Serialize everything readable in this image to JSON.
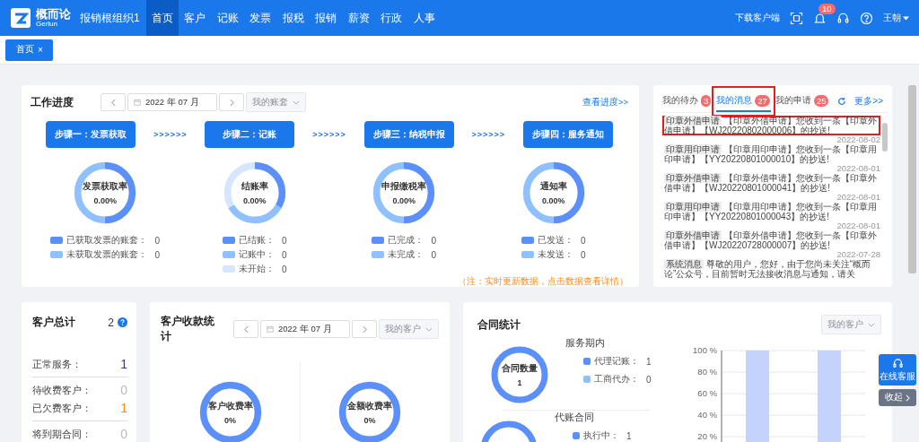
{
  "header": {
    "logo": {
      "name": "概而论",
      "subtitle": "Gerlun"
    },
    "org": "报销根组织1",
    "nav": [
      {
        "label": "首页",
        "selected": true
      },
      {
        "label": "客户",
        "selected": false
      },
      {
        "label": "记账",
        "selected": false
      },
      {
        "label": "发票",
        "selected": false
      },
      {
        "label": "报税",
        "selected": false
      },
      {
        "label": "报销",
        "selected": false
      },
      {
        "label": "薪资",
        "selected": false
      },
      {
        "label": "行政",
        "selected": false
      },
      {
        "label": "人事",
        "selected": false
      }
    ],
    "download": "下载客户端",
    "notification_count": "10",
    "user": "王朝"
  },
  "open_tabs": [
    {
      "label": "首页",
      "close": "×",
      "selected": true
    }
  ],
  "work_progress": {
    "title": "工作进度",
    "period": "2022 年 07 月",
    "account_select": "我的账套",
    "link": "查看进度>>",
    "steps": [
      {
        "label": "步骤一：发票获取",
        "connector": ">>>>>>",
        "rate_label": "发票获取率",
        "rate": "0.00%",
        "legend": [
          {
            "label": "已获取发票的账套：",
            "value": "0",
            "color": "#5b8ff9"
          },
          {
            "label": "未获取发票的账套：",
            "value": "0",
            "color": "#8fc0ff"
          }
        ]
      },
      {
        "label": "步骤二：记账",
        "connector": ">>>>>>",
        "rate_label": "结账率",
        "rate": "0.00%",
        "legend": [
          {
            "label": "已结账：",
            "value": "0",
            "color": "#5b8ff9"
          },
          {
            "label": "记账中：",
            "value": "0",
            "color": "#8fc0ff"
          },
          {
            "label": "未开始：",
            "value": "0",
            "color": "#d6e6ff"
          }
        ]
      },
      {
        "label": "步骤三：纳税申报",
        "connector": ">>>>>>",
        "rate_label": "申报缴税率",
        "rate": "0.00%",
        "legend": [
          {
            "label": "已完成：",
            "value": "0",
            "color": "#5b8ff9"
          },
          {
            "label": "未完成：",
            "value": "0",
            "color": "#8fc0ff"
          }
        ]
      },
      {
        "label": "步骤四：服务通知",
        "rate_label": "通知率",
        "rate": "0.00%",
        "legend": [
          {
            "label": "已发送：",
            "value": "0",
            "color": "#5b8ff9"
          },
          {
            "label": "未发送：",
            "value": "0",
            "color": "#8fc0ff"
          }
        ]
      }
    ],
    "note": "（注：实时更新数据，点击数据查看详情）"
  },
  "messages": {
    "tabs": [
      {
        "label": "我的待办",
        "count": "3",
        "selected": false,
        "highlighted": false
      },
      {
        "label": "我的消息",
        "count": "27",
        "selected": true,
        "highlighted": true
      },
      {
        "label": "我的申请",
        "count": "25",
        "selected": false,
        "highlighted": false
      }
    ],
    "more": "更多>>",
    "items": [
      {
        "tag": "印章外借申请",
        "text": "【印章外借申请】您收到一条【印章外借申请】【WJ20220802000006】的抄送!",
        "date": "2022-08-02",
        "highlighted": true
      },
      {
        "tag": "印章用印申请",
        "text": "【印章用印申请】您收到一条【印章用印申请】【YY20220801000010】的抄送!",
        "date": "2022-08-01",
        "highlighted": false
      },
      {
        "tag": "印章外借申请",
        "text": "【印章外借申请】您收到一条【印章外借申请】【WJ20220801000041】的抄送!",
        "date": "2022-08-01",
        "highlighted": false
      },
      {
        "tag": "印章用印申请",
        "text": "【印章用印申请】您收到一条【印章用印申请】【YY20220801000043】的抄送!",
        "date": "2022-08-01",
        "highlighted": false
      },
      {
        "tag": "印章外借申请",
        "text": "【印章外借申请】您收到一条【印章外借申请】【WJ20220728000007】的抄送!",
        "date": "2022-07-28",
        "highlighted": false
      },
      {
        "tag": "系统消息",
        "text": "尊敬的用户，您好，由于您尚未关注“概而论”公众号，目前暂时无法接收消息与通知，请关",
        "highlighted": false
      }
    ]
  },
  "customer_total": {
    "title": "客户总计",
    "total": "2",
    "groups": [
      [
        {
          "label": "正常服务：",
          "value": "1",
          "color": "#3c3c78"
        }
      ],
      [
        {
          "label": "待收费客户：",
          "value": "0",
          "color": "#bbbbbb"
        },
        {
          "label": "已欠费客户：",
          "value": "1",
          "color": "#fa8c16"
        }
      ],
      [
        {
          "label": "将到期合同：",
          "value": "0",
          "color": "#bbbbbb"
        }
      ]
    ]
  },
  "collection": {
    "title": "客户收款统计",
    "period": "2022 年 07 月",
    "customer_select": "我的客户",
    "rates": [
      {
        "label": "客户收费率",
        "value": "0%"
      },
      {
        "label": "金额收费率",
        "value": "0%"
      }
    ]
  },
  "contracts": {
    "title": "合同统计",
    "customer_select": "我的客户",
    "sections": [
      {
        "title": "服务期内",
        "donut_label": "合同数量",
        "donut_value": "1",
        "legend": [
          {
            "label": "代理记账：",
            "value": "1",
            "color": "#5b8ff9"
          },
          {
            "label": "工商代办：",
            "value": "0",
            "color": "#8fc0ff"
          }
        ]
      },
      {
        "title": "代账合同",
        "legend": [
          {
            "label": "执行中：",
            "value": "1",
            "color": "#5b8ff9"
          }
        ]
      }
    ],
    "chart_data": {
      "type": "bar",
      "grid": true,
      "ylim": [
        0,
        100
      ],
      "yticks": [
        {
          "value": 20,
          "label": "20 %"
        },
        {
          "value": 40,
          "label": "40 %"
        },
        {
          "value": 60,
          "label": "60 %"
        },
        {
          "value": 80,
          "label": "80 %"
        },
        {
          "value": 100,
          "label": "100 %"
        }
      ],
      "values": [
        100,
        100
      ]
    }
  },
  "float_service": {
    "service": "在线客服",
    "collapse": "收起"
  }
}
